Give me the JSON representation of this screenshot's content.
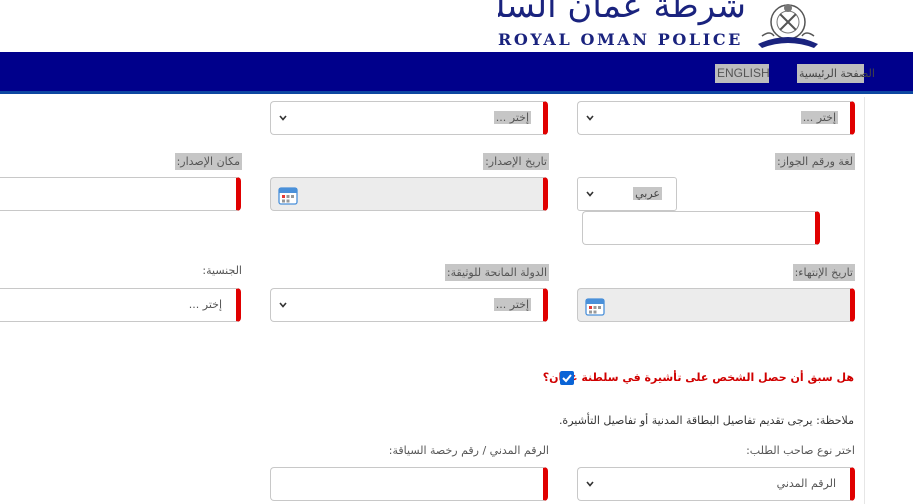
{
  "header": {
    "logo_arabic": "شرطة عُمان السلطانية",
    "logo_english": "ROYAL OMAN POLICE"
  },
  "nav": {
    "english": "ENGLISH",
    "home": "الصفحة الرئيسية"
  },
  "form": {
    "row1": {
      "select_right": "إختر ...",
      "select_middle": "إختر ..."
    },
    "labels": {
      "passport_language_number": "لغة ورقم الجواز:",
      "issue_date": "تاريخ الإصدار:",
      "issue_place": "مكان الإصدار:",
      "expiry_date": "تاريخ الإنتهاء:",
      "issuing_country": "الدولة المانحة للوثيقة:",
      "nationality": "الجنسية:",
      "applicant_type": "اختر نوع صاحب الطلب:",
      "civil_or_license": "الرقم المدني / رقم رخصة السياقة:"
    },
    "language_value": "عربي",
    "issuing_country_value": "إختر ...",
    "nationality_value": "إختر ...",
    "applicant_type_value": "الرقم المدني",
    "previous_visa_question": "هل سبق أن حصل الشخص على تأشيرة في سلطنة عمان؟",
    "previous_visa_checked": true,
    "note": "ملاحظة: يرجى تقديم تفاصيل البطاقة المدنية أو تفاصيل التأشيرة."
  }
}
